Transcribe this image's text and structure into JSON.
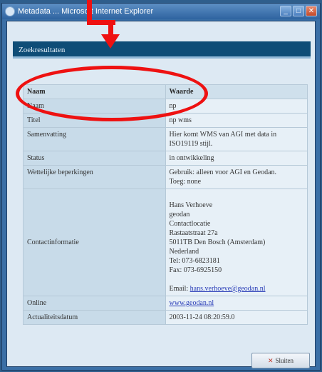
{
  "window": {
    "title": "Metadata ... Microsoft Internet Explorer",
    "buttons": {
      "minimize": "_",
      "maximize": "□",
      "close": "✕"
    }
  },
  "panel": {
    "header": "Zoekresultaten"
  },
  "table": {
    "headers": {
      "name": "Naam",
      "value": "Waarde"
    },
    "rows": [
      {
        "label": "Naam",
        "value": "np"
      },
      {
        "label": "Titel",
        "value": "np wms"
      },
      {
        "label": "Samenvatting",
        "value": "Hier komt WMS van AGI met data in ISO19119 stijl."
      },
      {
        "label": "Status",
        "value": "in ontwikkeling"
      },
      {
        "label": "Wettelijke beperkingen",
        "value": "Gebruik: alleen voor AGI en Geodan.\nToeg: none"
      },
      {
        "label": "Contactinformatie",
        "value": "Hans Verhoeve\ngeodan\nContactlocatie\nRastaatstraat 27a\n5011TB Den Bosch (Amsterdam)\nNederland\nTel: 073-6823181\nFax: 073-6925150",
        "email_label": "Email: ",
        "email": "hans.verhoeve@geodan.nl"
      },
      {
        "label": "Online",
        "value": "www.geodan.nl"
      },
      {
        "label": "Actualiteitsdatum",
        "value": "2003-11-24 08:20:59.0"
      }
    ]
  },
  "close_button": {
    "label": "Sluiten",
    "icon": "close-icon"
  },
  "colors": {
    "annotation": "#ee1111",
    "header": "#0e4d77"
  }
}
